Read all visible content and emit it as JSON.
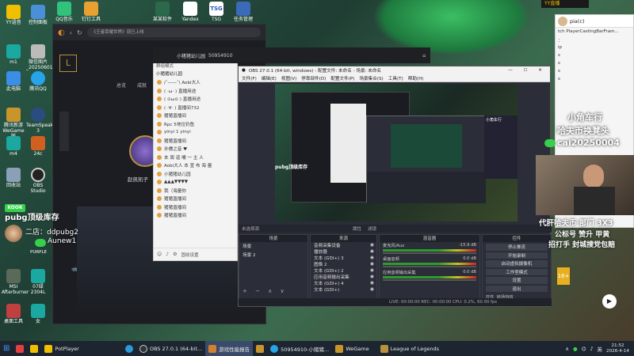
{
  "desktop": {
    "icons_col1": [
      "YY语音",
      "m1",
      "此电脑",
      "腾讯新游 WeGame版",
      "m4",
      "回收站",
      "pubg顶级库存",
      "登",
      "MSI Afterburner",
      "桌面工具"
    ],
    "icons_col2": [
      "控制面板",
      "微信图片_20250601...",
      "腾讯QQ",
      "TeamSpeak 3",
      "24c",
      "OBS Studio"
    ],
    "top_icons": [
      "QQ音乐",
      "钉钉工具",
      "某某软件",
      "Yandex",
      "TSG",
      "任务管理"
    ],
    "icon_labels_bottom": [
      "PURPLE",
      "07绿2304L",
      "女"
    ]
  },
  "browser": {
    "address": "《王者荣耀世界》现已上线",
    "game_tabs": [
      "总览",
      "成就"
    ],
    "player_name": "赵凯凯子"
  },
  "qq_window": {
    "title": "小猪猪幼儿园",
    "id": "50954910",
    "mode_label": "群组模式",
    "group_header": "小猪猪幼儿园",
    "rows": [
      "/ˆ——ˆ\\  Aobi大人",
      "( ·ω· )   直播用途",
      "( ⊙ω⊙ )  直播用途",
      "( ·∀· )   直播间732",
      "猪猪直播间",
      "Rpc 5地位钓鱼",
      "yinyi 1 yinyi",
      "猪猪直播间",
      "孙儒之音 ♥",
      "本 周 道 嘴 一 主 人",
      "Aobi大人  本 宣 布 海 量",
      "小猪猪幼儿园",
      "▲▲▲▼▼▼▼",
      "我（海量你",
      "猪猪直播间",
      "猪猪直播间",
      "猪猪直播间"
    ],
    "bottom_btn": "固收设置"
  },
  "obs": {
    "title": "OBS 27.0.1 (64-bit, windows) - 配置文件: 未命名 - 场景: 未命名",
    "menu": [
      "文件(F)",
      "编辑(E)",
      "视图(V)",
      "停靠部件(D)",
      "配置文件(P)",
      "场景集合(S)",
      "工具(T)",
      "帮助(H)"
    ],
    "no_source": "未选择源",
    "props_label": "属性",
    "filters_label": "滤镜",
    "docks": {
      "scenes": "场景",
      "sources": "来源",
      "mixer": "混音器",
      "controls": "控件"
    },
    "scenes": [
      "场景",
      "场景 2"
    ],
    "sources": [
      "音频采集设备",
      "播放器",
      "文本 (GDI+) 3",
      "图像 2",
      "文本 (GDI+) 2",
      "应用音频输出采集",
      "文本 (GDI+) 4",
      "文本 (GDI+)"
    ],
    "mixer": [
      {
        "name": "麦克风/Aux",
        "db": "-15.9 dB"
      },
      {
        "name": "桌面音频",
        "db": "0.0 dB"
      },
      {
        "name": "应用音频输出采集",
        "db": "0.0 dB"
      }
    ],
    "controls": [
      "停止推流",
      "开始录制",
      "启动虚拟摄像机",
      "工作室模式",
      "设置",
      "退出"
    ],
    "transition_label": "转场特效",
    "controls_tab": "控件",
    "status": "LIVE: 00:00:00   REC: 00:00:00   CPU: 0.2%, 60.00 fps"
  },
  "stream_overlay": {
    "logo_badge": "KOOK",
    "inventory": "pubg顶级库存",
    "second_admin": "二店：ddpubg2",
    "user": "Aunew1",
    "right_title": "小角车行",
    "right_sub": "哈夫币换凳头",
    "wechat": "cai20250004",
    "promo1": "代肝哈夫币 部门 3X3",
    "promo2": "公标号 赞升 甲黄",
    "promo3": "招打手 封城搜党包赔"
  },
  "chat_panel": {
    "yy_label": "YY直播",
    "name": "pia(c)",
    "lines": [
      "tch PlayerCastingBarFram...",
      "：",
      "ip",
      "s",
      "s",
      "s",
      "s"
    ]
  },
  "taskbar": {
    "items": [
      "PotPlayer",
      "OBS 27.0.1 (64-bit...",
      "游戏性能报告",
      "50954910-小猪猪...",
      "WeGame",
      "League of Legends"
    ],
    "time": "21:52",
    "date": "2026-4-14",
    "lang": "英",
    "status_word": "状态"
  },
  "colors": {
    "accent_green": "#36d14a",
    "obs_bg": "#2b2e38",
    "qq_bg": "#f3f3f3",
    "taskbar": "#1c2530"
  }
}
